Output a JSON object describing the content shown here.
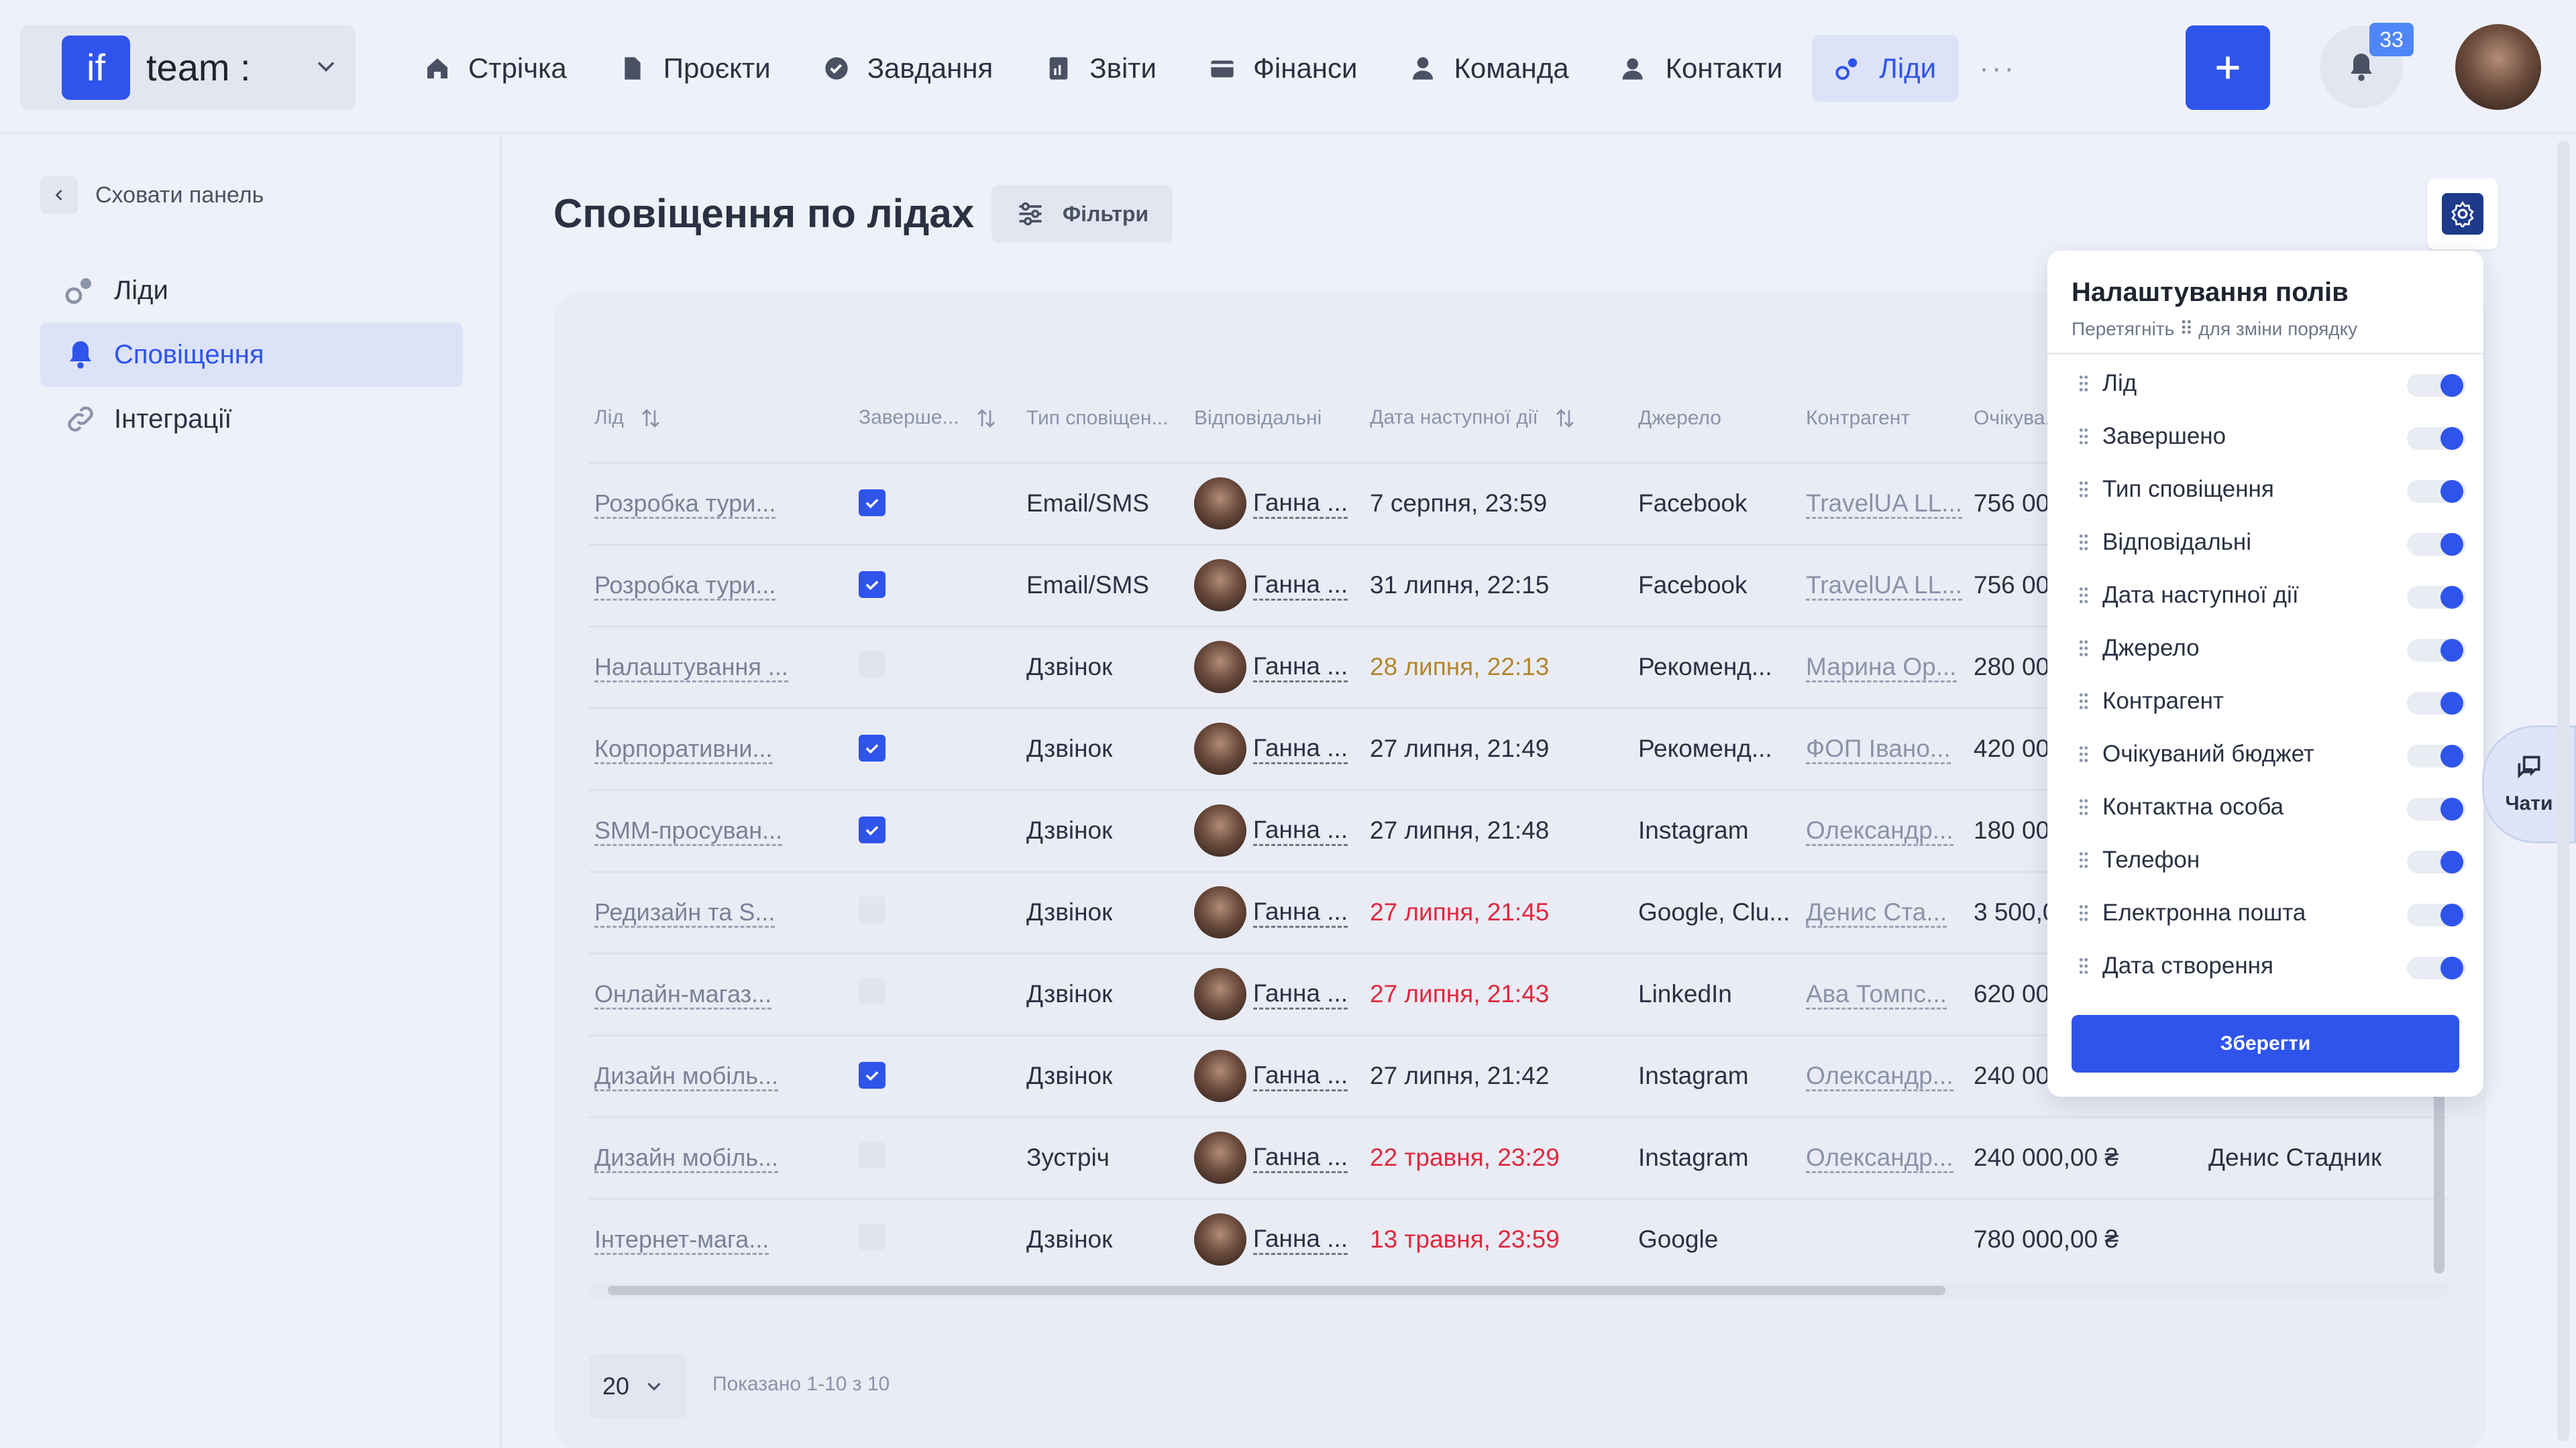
{
  "brand": {
    "logo": "if",
    "name": "team :"
  },
  "nav": {
    "items": [
      {
        "label": "Стрічка",
        "icon": "home-icon"
      },
      {
        "label": "Проєкти",
        "icon": "file-icon"
      },
      {
        "label": "Завдання",
        "icon": "check-circle-icon"
      },
      {
        "label": "Звіти",
        "icon": "report-icon"
      },
      {
        "label": "Фінанси",
        "icon": "wallet-icon"
      },
      {
        "label": "Команда",
        "icon": "person-icon"
      },
      {
        "label": "Контакти",
        "icon": "contacts-icon"
      },
      {
        "label": "Ліди",
        "icon": "leads-icon",
        "active": true
      }
    ],
    "more": "···"
  },
  "notifications": {
    "count": "33"
  },
  "sidebar": {
    "hide_label": "Сховати панель",
    "items": [
      {
        "label": "Ліди"
      },
      {
        "label": "Сповіщення",
        "active": true
      },
      {
        "label": "Інтеграції"
      }
    ]
  },
  "main": {
    "title": "Сповіщення по лідах",
    "filters_label": "Фільтри"
  },
  "table": {
    "headers": {
      "lead": "Лід",
      "done": "Заверше...",
      "type": "Тип сповіщен...",
      "resp": "Відповідальні",
      "next": "Дата наступної дії",
      "source": "Джерело",
      "client": "Контрагент",
      "budget": "Очікува..."
    },
    "rows": [
      {
        "lead": "Розробка тури...",
        "done": true,
        "type": "Email/SMS",
        "resp": "Ганна ...",
        "next": "7 серпня, 23:59",
        "next_status": "normal",
        "source": "Facebook",
        "client": "TravelUA LL...",
        "budget": "756 000,00 ₴",
        "contact": ""
      },
      {
        "lead": "Розробка тури...",
        "done": true,
        "type": "Email/SMS",
        "resp": "Ганна ...",
        "next": "31 липня, 22:15",
        "next_status": "normal",
        "source": "Facebook",
        "client": "TravelUA LL...",
        "budget": "756 000,00 ₴",
        "contact": ""
      },
      {
        "lead": "Налаштування ...",
        "done": false,
        "type": "Дзвінок",
        "resp": "Ганна ...",
        "next": "28 липня, 22:13",
        "next_status": "warning",
        "source": "Рекоменд...",
        "client": "Марина Ор...",
        "budget": "280 000,00 ₴",
        "contact": ""
      },
      {
        "lead": "Корпоративни...",
        "done": true,
        "type": "Дзвінок",
        "resp": "Ганна ...",
        "next": "27 липня, 21:49",
        "next_status": "normal",
        "source": "Рекоменд...",
        "client": "ФОП Івано...",
        "budget": "420 000,00 ₴",
        "contact": ""
      },
      {
        "lead": "SMM-просуван...",
        "done": true,
        "type": "Дзвінок",
        "resp": "Ганна ...",
        "next": "27 липня, 21:48",
        "next_status": "normal",
        "source": "Instagram",
        "client": "Олександр...",
        "budget": "180 000,00 ₴",
        "contact": ""
      },
      {
        "lead": "Редизайн та S...",
        "done": false,
        "type": "Дзвінок",
        "resp": "Ганна ...",
        "next": "27 липня, 21:45",
        "next_status": "overdue",
        "source": "Google, Clu...",
        "client": "Денис Ста...",
        "budget": "3 500,00 ₴",
        "contact": ""
      },
      {
        "lead": "Онлайн-магаз...",
        "done": false,
        "type": "Дзвінок",
        "resp": "Ганна ...",
        "next": "27 липня, 21:43",
        "next_status": "overdue",
        "source": "LinkedIn",
        "client": "Ава Томпс...",
        "budget": "620 000,00 ₴",
        "contact": ""
      },
      {
        "lead": "Дизайн мобіль...",
        "done": true,
        "type": "Дзвінок",
        "resp": "Ганна ...",
        "next": "27 липня, 21:42",
        "next_status": "normal",
        "source": "Instagram",
        "client": "Олександр...",
        "budget": "240 000,00 ₴",
        "contact": ""
      },
      {
        "lead": "Дизайн мобіль...",
        "done": false,
        "type": "Зустріч",
        "resp": "Ганна ...",
        "next": "22 травня, 23:29",
        "next_status": "overdue",
        "source": "Instagram",
        "client": "Олександр...",
        "budget": "240 000,00 ₴",
        "contact": "Денис Стадник"
      },
      {
        "lead": "Інтернет-мага...",
        "done": false,
        "type": "Дзвінок",
        "resp": "Ганна ...",
        "next": "13 травня, 23:59",
        "next_status": "overdue",
        "source": "Google",
        "client": "",
        "budget": "780 000,00 ₴",
        "contact": ""
      }
    ]
  },
  "pagination": {
    "page_size": "20",
    "shown": "Показано 1-10 з 10"
  },
  "field_settings": {
    "title": "Налаштування полів",
    "subtitle": "Перетягніть ⠿ для зміни порядку",
    "fields": [
      {
        "label": "Лід",
        "enabled": true
      },
      {
        "label": "Завершено",
        "enabled": true
      },
      {
        "label": "Тип сповіщення",
        "enabled": true
      },
      {
        "label": "Відповідальні",
        "enabled": true
      },
      {
        "label": "Дата наступної дії",
        "enabled": true
      },
      {
        "label": "Джерело",
        "enabled": true
      },
      {
        "label": "Контрагент",
        "enabled": true
      },
      {
        "label": "Очікуваний бюджет",
        "enabled": true
      },
      {
        "label": "Контактна особа",
        "enabled": true
      },
      {
        "label": "Телефон",
        "enabled": true
      },
      {
        "label": "Електронна пошта",
        "enabled": true
      },
      {
        "label": "Дата створення",
        "enabled": true
      }
    ],
    "save_label": "Зберегти"
  },
  "chats": {
    "label": "Чати"
  },
  "colors": {
    "accent": "#2f54eb",
    "overdue": "#e0283d",
    "warning": "#b3862d"
  }
}
